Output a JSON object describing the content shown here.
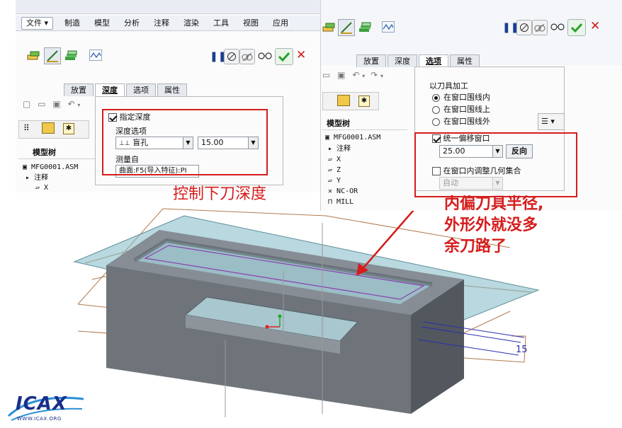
{
  "left_window": {
    "menu": [
      "文件",
      "制造",
      "模型",
      "分析",
      "注释",
      "渲染",
      "工具",
      "视图",
      "应用"
    ],
    "tabs": [
      "放置",
      "深度",
      "选项",
      "属性"
    ],
    "active_tab": "深度",
    "depth_panel": {
      "specify_depth_label": "指定深度",
      "specify_depth_checked": true,
      "depth_options_label": "深度选项",
      "depth_type_value": "盲孔",
      "depth_value": "15.00",
      "measure_from_label": "测量自",
      "measure_from_value": "曲面:F5(导入特征):PI"
    },
    "model_tree": {
      "title": "模型树",
      "items": [
        "MFG0001.ASM",
        "注释",
        "X"
      ]
    }
  },
  "right_window": {
    "tabs": [
      "放置",
      "深度",
      "选项",
      "属性"
    ],
    "active_tab": "选项",
    "options_panel": {
      "tool_machining_label": "以刀具加工",
      "radio_options": [
        "在窗口围线内",
        "在窗口围线上",
        "在窗口围线外"
      ],
      "selected_radio": 0,
      "offset_label": "统一偏移窗口",
      "offset_checked": true,
      "offset_value": "25.00",
      "reverse_button": "反向",
      "adjust_geom_label": "在窗口内调整几何集合",
      "adjust_geom_checked": false,
      "auto_value": "自动"
    },
    "model_tree": {
      "title": "模型树",
      "items": [
        "MFG0001.ASM",
        "注释",
        "X",
        "Z",
        "Y",
        "NC-OR",
        "MILL"
      ]
    }
  },
  "annotations": {
    "depth_note": "控制下刀深度",
    "offset_note_line1": "内偏刀具半径,",
    "offset_note_line2": "外形外就没多",
    "offset_note_line3": "余刀路了"
  },
  "logo_text": "ICAX",
  "logo_url": "WWW.ICAX.ORG",
  "colors": {
    "annotation_red": "#d61c1c",
    "confirm_green": "#2aa02a",
    "cancel_red": "#d11c1c",
    "model_body": "#6e747a",
    "window_plane": "#7fb8c4"
  }
}
